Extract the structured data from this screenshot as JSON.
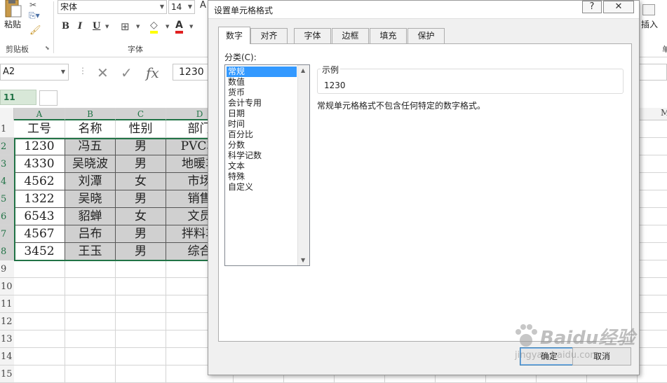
{
  "ribbon": {
    "clipboard": {
      "paste_label": "粘贴",
      "group_label": "剪贴板"
    },
    "font": {
      "family": "宋体",
      "size": "14",
      "group_label": "字体",
      "bold": "B",
      "italic": "I",
      "underline": "U"
    },
    "insert_label": "插入",
    "partial_label": "单"
  },
  "formula_bar": {
    "cell_ref": "A2",
    "fx": "fx",
    "value": "1230"
  },
  "outline": {
    "level_label": "11"
  },
  "columns": [
    "A",
    "B",
    "C",
    "D"
  ],
  "far_column": "M",
  "row_numbers": [
    "1",
    "2",
    "3",
    "4",
    "5",
    "6",
    "7",
    "8",
    "9",
    "10",
    "11",
    "12",
    "13",
    "14",
    "15"
  ],
  "table": {
    "header": [
      "工号",
      "名称",
      "性别",
      "部门"
    ],
    "rows": [
      [
        "1230",
        "冯五",
        "男",
        "PVC车"
      ],
      [
        "4330",
        "吴晓波",
        "男",
        "地暖车"
      ],
      [
        "4562",
        "刘潭",
        "女",
        "市场"
      ],
      [
        "1322",
        "吴晓",
        "男",
        "销售"
      ],
      [
        "6543",
        "貂蝉",
        "女",
        "文员"
      ],
      [
        "4567",
        "吕布",
        "男",
        "拌料车"
      ],
      [
        "3452",
        "王玉",
        "男",
        "综合"
      ]
    ]
  },
  "dialog": {
    "title": "设置单元格格式",
    "help_btn": "?",
    "close_btn": "✕",
    "tabs": [
      "数字",
      "对齐",
      "字体",
      "边框",
      "填充",
      "保护"
    ],
    "category_label": "分类(C):",
    "categories": [
      "常规",
      "数值",
      "货币",
      "会计专用",
      "日期",
      "时间",
      "百分比",
      "分数",
      "科学记数",
      "文本",
      "特殊",
      "自定义"
    ],
    "selected_category": "常规",
    "sample_label": "示例",
    "sample_value": "1230",
    "description": "常规单元格格式不包含任何特定的数字格式。",
    "ok_label": "确定",
    "cancel_label": "取消"
  },
  "watermark": {
    "brand": "Baidu经验",
    "url": "jingyan.baidu.com"
  }
}
